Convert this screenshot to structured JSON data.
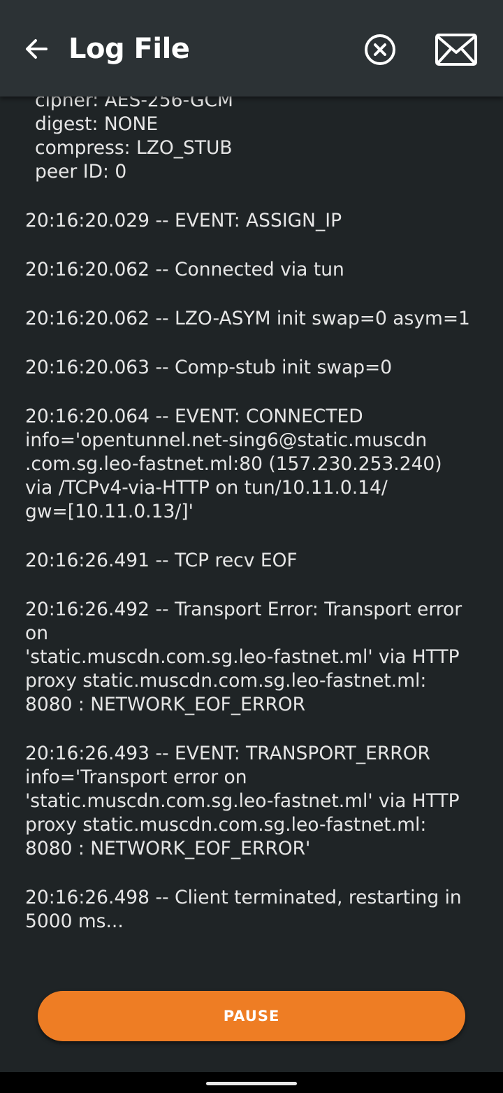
{
  "app_bar": {
    "title": "Log File",
    "back_icon": "arrow-left-icon",
    "clear_icon": "close-circle-icon",
    "send_icon": "envelope-icon"
  },
  "log": {
    "header_lines": "cipher: AES-256-GCM\ndigest: NONE\ncompress: LZO_STUB\npeer ID: 0",
    "entries": [
      "20:16:20.029 -- EVENT: ASSIGN_IP",
      "20:16:20.062 -- Connected via tun",
      "20:16:20.062 -- LZO-ASYM init swap=0 asym=1",
      "20:16:20.063 -- Comp-stub init swap=0",
      "20:16:20.064 -- EVENT: CONNECTED\ninfo='opentunnel.net-sing6@static.muscdn\n.com.sg.leo-fastnet.ml:80 (157.230.253.240)\nvia /TCPv4-via-HTTP on tun/10.11.0.14/\ngw=[10.11.0.13/]'",
      "20:16:26.491 -- TCP recv EOF",
      "20:16:26.492 -- Transport Error: Transport error on\n'static.muscdn.com.sg.leo-fastnet.ml' via HTTP\nproxy static.muscdn.com.sg.leo-fastnet.ml:\n8080 : NETWORK_EOF_ERROR",
      "20:16:26.493 -- EVENT: TRANSPORT_ERROR\ninfo='Transport error on\n'static.muscdn.com.sg.leo-fastnet.ml' via HTTP\nproxy static.muscdn.com.sg.leo-fastnet.ml:\n8080 : NETWORK_EOF_ERROR'",
      "20:16:26.498 -- Client terminated, restarting in\n5000 ms..."
    ]
  },
  "actions": {
    "pause_label": "PAUSE"
  },
  "colors": {
    "app_bar_bg": "#2c3235",
    "screen_bg": "#1f2426",
    "accent": "#ee7d24",
    "text": "#e6e6e6"
  }
}
